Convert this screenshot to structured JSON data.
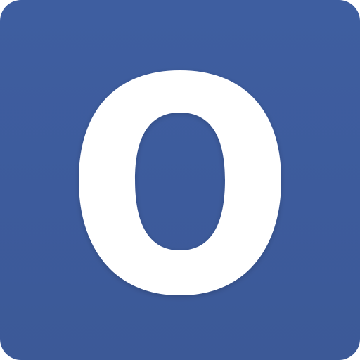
{
  "icon": {
    "semantic": "letter-o-app-icon",
    "glyph": "O",
    "colors": {
      "background": "#3d5b9c",
      "glyph": "#ffffff"
    }
  }
}
